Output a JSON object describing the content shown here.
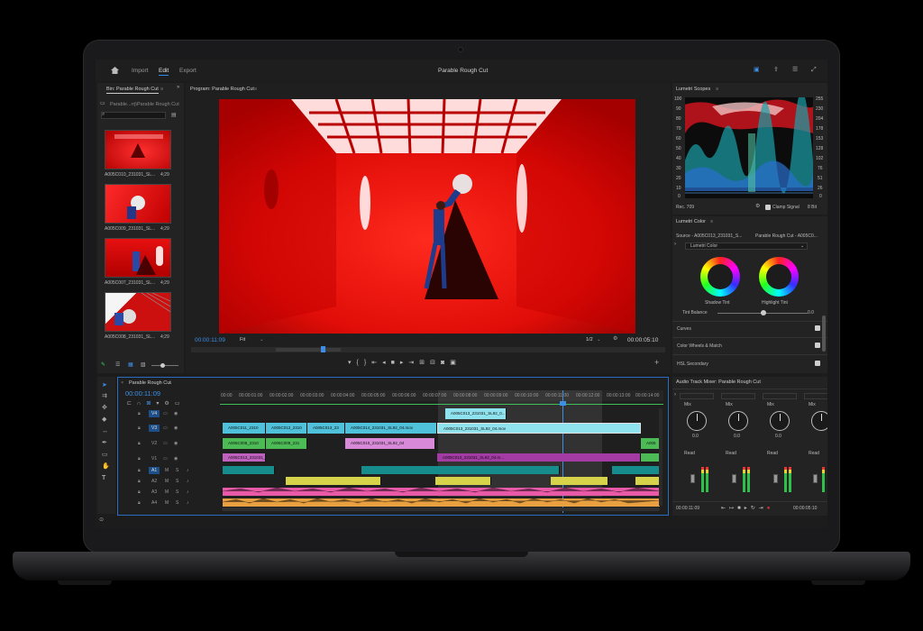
{
  "header": {
    "nav": [
      "Import",
      "Edit",
      "Export"
    ],
    "active_nav": "Edit",
    "title": "Parable Rough Cut"
  },
  "bin": {
    "title": "Bin: Parable Rough Cut",
    "path": "Parable...rrj\\Parable Rough Cut",
    "clips": [
      {
        "name": "A005C010_231031_SL...",
        "duration": "4;29"
      },
      {
        "name": "A005C009_231031_SL...",
        "duration": "4;29"
      },
      {
        "name": "A005C007_231031_SL...",
        "duration": "4;29"
      },
      {
        "name": "A005C008_231031_SL...",
        "duration": "4;29"
      }
    ]
  },
  "program": {
    "title": "Program: Parable Rough Cut",
    "current_time": "00:00:11:09",
    "fit": "Fit",
    "resolution": "1/2",
    "duration": "00:00:05:10"
  },
  "scopes": {
    "title": "Lumetri Scopes",
    "scale_left": [
      "100",
      "90",
      "80",
      "70",
      "60",
      "50",
      "40",
      "30",
      "20",
      "10",
      "0"
    ],
    "scale_right": [
      "255",
      "230",
      "204",
      "178",
      "153",
      "128",
      "102",
      "76",
      "51",
      "26",
      "0"
    ],
    "standard": "Rec. 709",
    "clamp_label": "Clamp Signal",
    "bits": "8 Bit"
  },
  "lumetri": {
    "title": "Lumetri Color",
    "source": "Source - A005C013_231031_S...",
    "target": "Parable Rough Cut - A005C0...",
    "preset": "Lumetri Color",
    "shadow_label": "Shadow Tint",
    "highlight_label": "Highlight Tint",
    "tint_balance_label": "Tint Balance",
    "tint_balance_value": "0.0",
    "sections": [
      "Curves",
      "Color Wheels & Match",
      "HSL Secondary"
    ]
  },
  "timeline": {
    "title": "Parable Rough Cut",
    "timecode": "00:00:11:09",
    "ruler": [
      "00:00",
      "00:00:01:00",
      "00:00:02:00",
      "00:00:03:00",
      "00:00:04:00",
      "00:00:05:00",
      "00:00:06:00",
      "00:00:07:00",
      "00:00:08:00",
      "00:00:09:00",
      "00:00:10:00",
      "00:00:11:00",
      "00:00:12:00",
      "00:00:13:00",
      "00:00:14:00"
    ],
    "video_tracks": [
      "V4",
      "V3",
      "V2",
      "V1"
    ],
    "audio_tracks": [
      "A1",
      "A2",
      "A3",
      "A4"
    ],
    "v4_clip": "A005C013_231031_SL92_0...",
    "v3_clips": [
      "A005C011_2310",
      "A005C012_2310",
      "A005C013_23",
      "A005C014_231031_SL92_04.mov",
      "A005C013_231031_SL92_04.mov"
    ],
    "v2_clips": [
      "A005C008_2310",
      "A005C009_231",
      "A005C010_231031_SL92_04",
      "A005"
    ],
    "v1_clips": [
      "A005C013_231031_...",
      "A005C013_231031_SL92_04.m..."
    ]
  },
  "mixer": {
    "title": "Audio Track Mixer: Parable Rough Cut",
    "mode": "Mix",
    "read": "Read",
    "value": "0.0",
    "current_time": "00:00:11:09",
    "duration": "00:00:05:10"
  }
}
